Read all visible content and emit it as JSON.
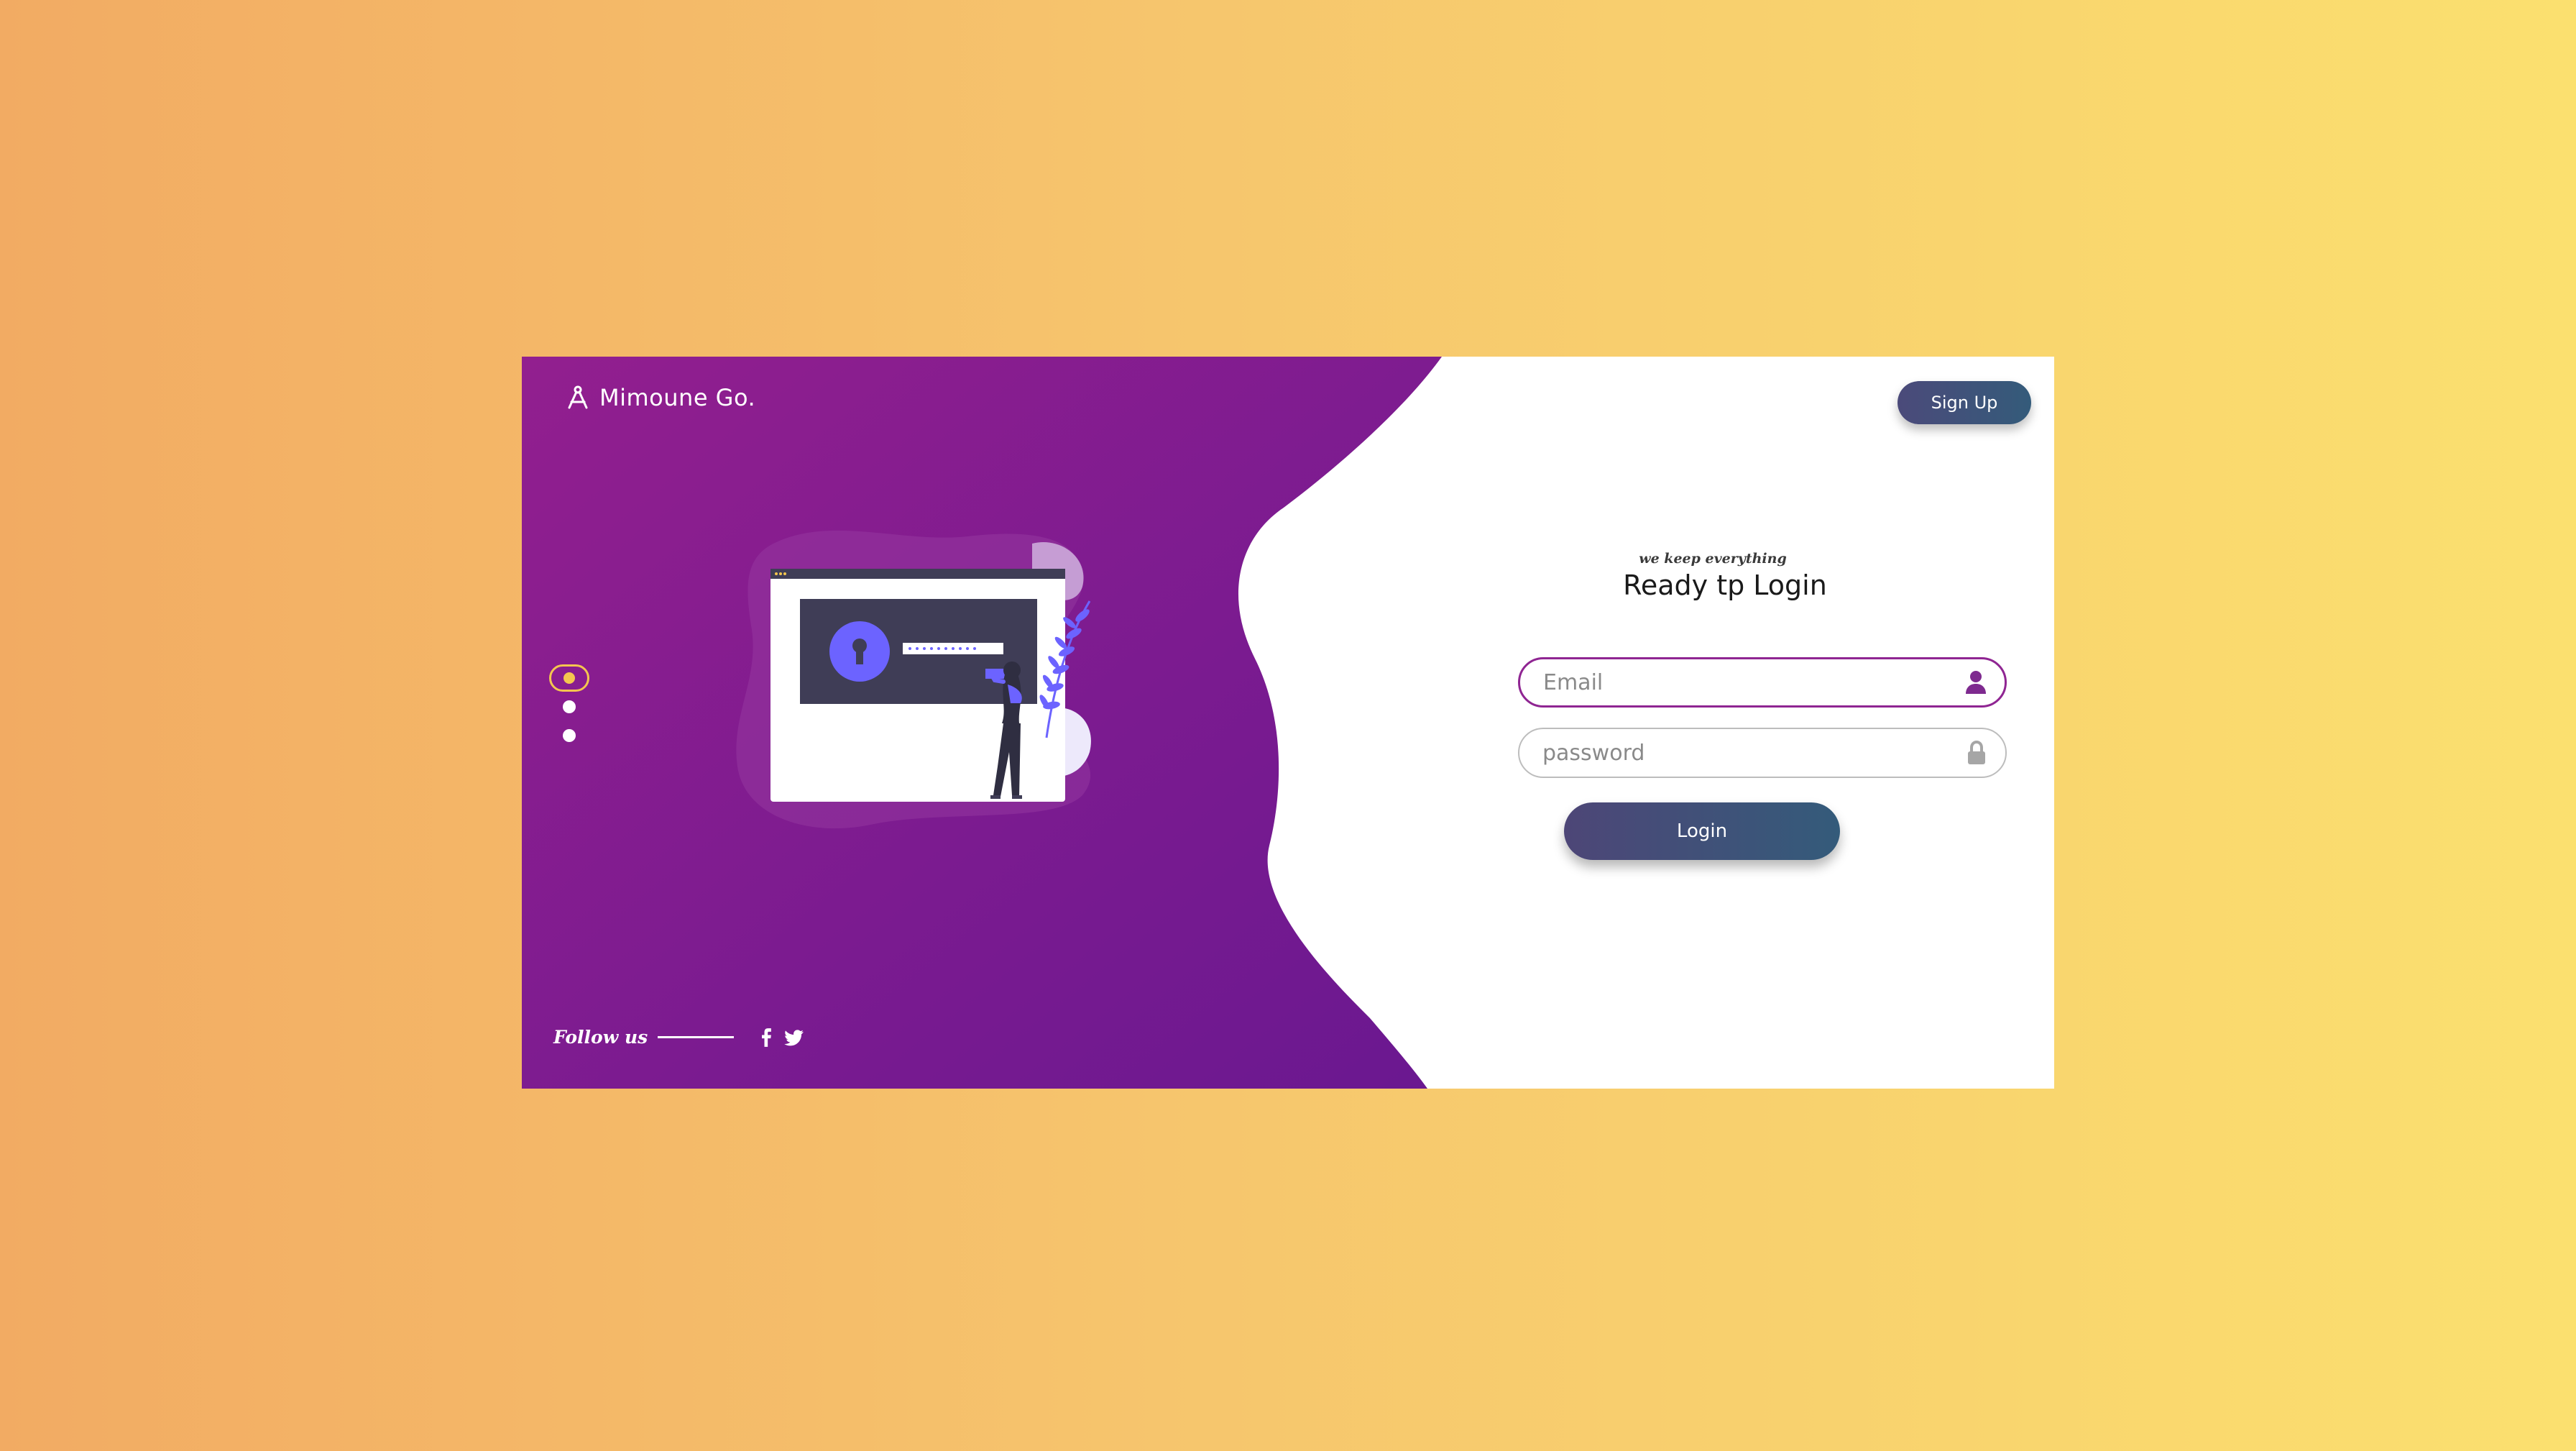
{
  "brand": {
    "name": "Mimoune Go.",
    "icon": "compass-logo-icon"
  },
  "header": {
    "signup_label": "Sign Up"
  },
  "slider": {
    "dots": [
      {
        "state": "active",
        "icon": "slider-dot-active"
      },
      {
        "state": "inactive",
        "icon": "slider-dot"
      },
      {
        "state": "inactive",
        "icon": "slider-dot"
      }
    ]
  },
  "illustration": {
    "icons": [
      "keyhole-icon",
      "password-mask-icon",
      "woman-figure",
      "leaf-plant"
    ]
  },
  "footer": {
    "follow_label": "Follow us",
    "social": [
      {
        "name": "facebook",
        "icon": "facebook-icon"
      },
      {
        "name": "twitter",
        "icon": "twitter-icon"
      }
    ]
  },
  "form": {
    "tagline": "we keep everything",
    "title": "Ready tp Login",
    "email": {
      "placeholder": "Email",
      "value": "",
      "icon": "user-icon"
    },
    "password": {
      "placeholder": "password",
      "value": "",
      "icon": "lock-icon"
    },
    "login_label": "Login"
  },
  "colors": {
    "purple_panel": "#8e2392",
    "purple_dark": "#6b1a8c",
    "accent_yellow": "#f4c64f",
    "button_start": "#4b4a7a",
    "button_end": "#345b7a",
    "illustration_blue": "#6c63ff",
    "illustration_dark": "#3f3d56",
    "bg_left": "#f2ab63",
    "bg_right": "#fbe06f"
  }
}
